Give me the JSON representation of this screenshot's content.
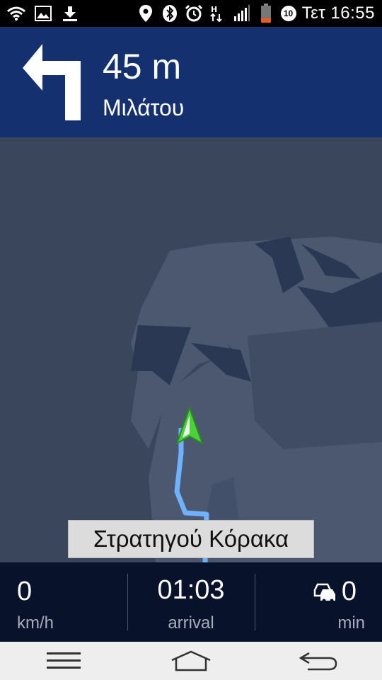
{
  "status_bar": {
    "time": "Τετ 16:55",
    "notification_badge": "10",
    "icons": [
      "wifi-icon",
      "image-icon",
      "download-icon",
      "location-icon",
      "bluetooth-icon",
      "alarm-icon",
      "data-transfer-icon",
      "signal-icon",
      "battery-icon"
    ]
  },
  "instruction": {
    "distance": "45 m",
    "street": "Μιλάτου",
    "turn_icon": "turn-left-icon"
  },
  "map": {
    "current_street": "Στρατηγού Κόρακα",
    "route_color": "#6fb1ff",
    "position_marker_color": "#4cd13a"
  },
  "info": {
    "speed_value": "0",
    "speed_unit": "km/h",
    "arrival_time": "01:03",
    "arrival_label": "arrival",
    "traffic_delay": "0",
    "traffic_unit": "min",
    "traffic_icon": "traffic-cars-icon"
  },
  "navbar": {
    "buttons": [
      "menu-icon",
      "home-icon",
      "back-icon"
    ]
  },
  "colors": {
    "banner": "#14306e",
    "map_background": "#3a465c",
    "infobar": "#08122b"
  }
}
